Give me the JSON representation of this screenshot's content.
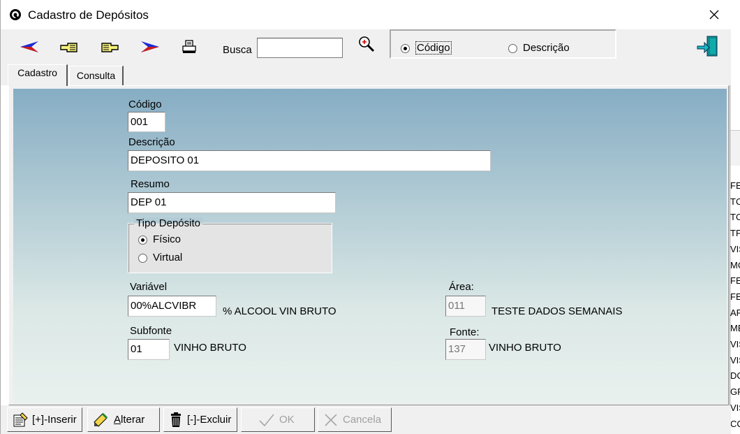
{
  "window": {
    "title": "Cadastro de Depósitos",
    "close_glyph": "✕"
  },
  "toolbar": {
    "busca_label": "Busca",
    "busca_value": "",
    "search_options": [
      {
        "label": "Código",
        "selected": true
      },
      {
        "label": "Descrição",
        "selected": false
      }
    ]
  },
  "tabs": [
    {
      "label": "Cadastro",
      "active": true
    },
    {
      "label": "Consulta",
      "active": false
    }
  ],
  "form": {
    "codigo": {
      "label": "Código",
      "value": "001"
    },
    "descricao": {
      "label": "Descrição",
      "value": "DEPOSITO 01"
    },
    "resumo": {
      "label": "Resumo",
      "value": "DEP 01"
    },
    "tipo_deposito": {
      "legend": "Tipo Depósito",
      "options": [
        {
          "label": "Físico",
          "selected": true
        },
        {
          "label": "Virtual",
          "selected": false
        }
      ]
    },
    "variavel": {
      "label": "Variável",
      "value": "00%ALCVIBR",
      "desc": "% ALCOOL VIN BRUTO"
    },
    "subfonte": {
      "label": "Subfonte",
      "value": "01",
      "desc": "VINHO BRUTO"
    },
    "area": {
      "label": "Área:",
      "value": "011",
      "desc": "TESTE DADOS SEMANAIS"
    },
    "fonte": {
      "label": "Fonte:",
      "value": "137",
      "desc": "VINHO BRUTO"
    }
  },
  "bottom_buttons": {
    "inserir": "[+]-Inserir",
    "alterar_first": "A",
    "alterar_rest": "lterar",
    "excluir": "[-]-Excluir",
    "ok": "OK",
    "cancela": "Cancela"
  },
  "background_app": {
    "rows": [
      "FE",
      "TC",
      "TC",
      "TF",
      "VIS",
      "MC",
      "FE",
      "FE",
      "AF",
      "ME",
      "VIS",
      "VIS",
      "DC",
      "GF",
      "VIS",
      "CC"
    ]
  },
  "colors": {
    "form_gradient_top": "#86adc4",
    "form_gradient_bottom": "#e9f1ee",
    "chrome": "#f0f0f0"
  }
}
